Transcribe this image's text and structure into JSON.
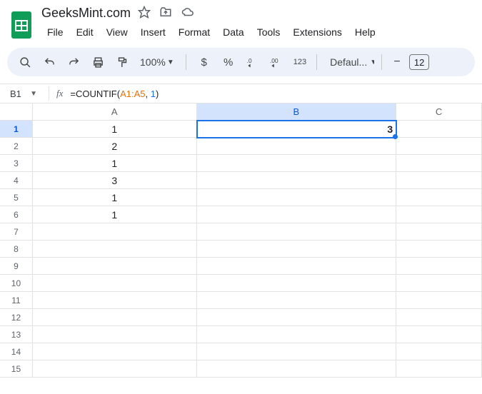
{
  "doc": {
    "title": "GeeksMint.com"
  },
  "menu": {
    "file": "File",
    "edit": "Edit",
    "view": "View",
    "insert": "Insert",
    "format": "Format",
    "data": "Data",
    "tools": "Tools",
    "extensions": "Extensions",
    "help": "Help"
  },
  "toolbar": {
    "zoom": "100%",
    "currency": "$",
    "percent": "%",
    "dec_dec": ".0",
    "dec_inc": ".00",
    "numfmt": "123",
    "font": "Defaul...",
    "fontsize": "12"
  },
  "namebox": {
    "ref": "B1"
  },
  "formula": {
    "prefix": "=COUNTIF(",
    "range": "A1:A5",
    "sep": ", ",
    "arg": "1",
    "suffix": ")"
  },
  "columns": {
    "A": "A",
    "B": "B",
    "C": "C"
  },
  "rows": [
    "1",
    "2",
    "3",
    "4",
    "5",
    "6",
    "7",
    "8",
    "9",
    "10",
    "11",
    "12",
    "13",
    "14",
    "15"
  ],
  "cells": {
    "A1": "1",
    "A2": "2",
    "A3": "1",
    "A4": "3",
    "A5": "1",
    "A6": "1",
    "B1": "3"
  },
  "chart_data": {
    "type": "table",
    "active_cell": "B1",
    "formula": "=COUNTIF(A1:A5, 1)",
    "columns": [
      "A",
      "B",
      "C"
    ],
    "data": {
      "A": [
        1,
        2,
        1,
        3,
        1,
        1
      ],
      "B": [
        3
      ]
    }
  }
}
